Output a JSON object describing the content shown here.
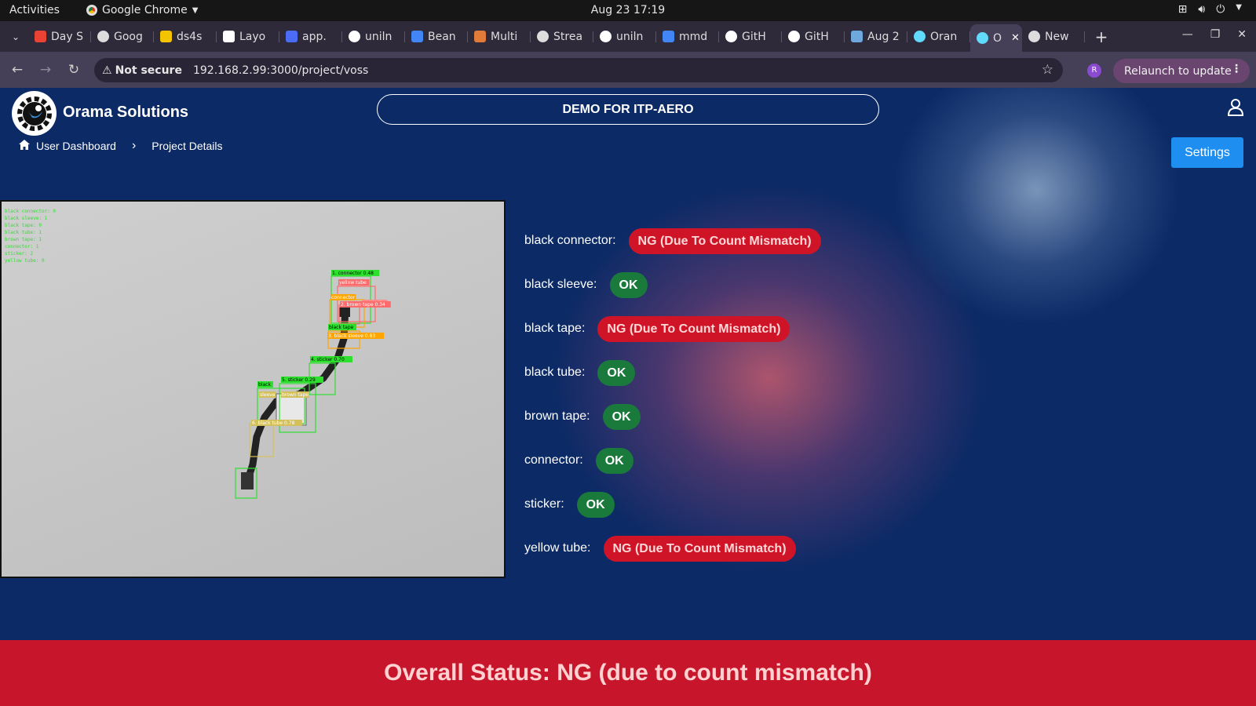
{
  "os": {
    "activities": "Activities",
    "app_name": "Google Chrome",
    "clock": "Aug 23  17:19"
  },
  "browser": {
    "tabs": [
      {
        "label": "Day S",
        "icon": "gmail-icon",
        "color": "#ea4335"
      },
      {
        "label": "Goog",
        "icon": "openai-icon",
        "color": "#dddddd"
      },
      {
        "label": "ds4s",
        "icon": "hugging-face-icon",
        "color": "#f4c400"
      },
      {
        "label": "Layo",
        "icon": "medium-icon",
        "color": "#ffffff"
      },
      {
        "label": "app.",
        "icon": "app-icon",
        "color": "#4a6cf7"
      },
      {
        "label": "uniln",
        "icon": "github-icon",
        "color": "#ffffff"
      },
      {
        "label": "Bean",
        "icon": "google-icon",
        "color": "#4285f4"
      },
      {
        "label": "Multi",
        "icon": "multi-icon",
        "color": "#e07b39"
      },
      {
        "label": "Strea",
        "icon": "openai-icon",
        "color": "#dddddd"
      },
      {
        "label": "uniln",
        "icon": "github-icon",
        "color": "#ffffff"
      },
      {
        "label": "mmd",
        "icon": "google-icon",
        "color": "#4285f4"
      },
      {
        "label": "GitH",
        "icon": "github-icon",
        "color": "#ffffff"
      },
      {
        "label": "GitH",
        "icon": "github-icon",
        "color": "#ffffff"
      },
      {
        "label": "Aug 2",
        "icon": "sparkle-icon",
        "color": "#6fa8dc"
      },
      {
        "label": "Oran",
        "icon": "react-icon",
        "color": "#61dafb"
      }
    ],
    "active_tab": {
      "label": "O",
      "icon": "react-icon",
      "color": "#61dafb"
    },
    "last_tab": {
      "label": "New",
      "icon": "chrome-icon",
      "color": "#dddddd"
    },
    "security_label": "Not secure",
    "url": "192.168.2.99:3000/project/voss",
    "profile_initial": "R",
    "relaunch_label": "Relaunch to update"
  },
  "app": {
    "brand": "Orama Solutions",
    "project_title": "DEMO FOR ITP-AERO",
    "breadcrumb": {
      "home": "User Dashboard",
      "current": "Project Details"
    },
    "settings_label": "Settings",
    "overall_status": "Overall Status: NG (due to count mismatch)",
    "status_colors": {
      "ok": "#1a7a3c",
      "ng": "#d01427"
    },
    "results": [
      {
        "label": "black connector:",
        "status": "NG (Due To Count Mismatch)",
        "kind": "ng"
      },
      {
        "label": "black sleeve:",
        "status": "OK",
        "kind": "ok"
      },
      {
        "label": "black tape:",
        "status": "NG (Due To Count Mismatch)",
        "kind": "ng"
      },
      {
        "label": "black tube:",
        "status": "OK",
        "kind": "ok"
      },
      {
        "label": "brown tape:",
        "status": "OK",
        "kind": "ok"
      },
      {
        "label": "connector:",
        "status": "OK",
        "kind": "ok"
      },
      {
        "label": "sticker:",
        "status": "OK",
        "kind": "ok"
      },
      {
        "label": "yellow tube:",
        "status": "NG (Due To Count Mismatch)",
        "kind": "ng"
      }
    ],
    "camera": {
      "overlay_counts": [
        "black connector: 0",
        "black sleeve: 1",
        "black tape: 0",
        "black tube: 1",
        "brown tape: 1",
        "connector: 1",
        "sticker: 2",
        "yellow tube: 0"
      ],
      "detections": [
        "1. connector 0.48",
        "yellow tube",
        "connector",
        "connector",
        "2. brown tape 0.34",
        "black tape",
        "3. black sleeve 0.83",
        "4. sticker 0.70",
        "5. sticker 0.29",
        "black",
        "sleeve",
        "brown tape",
        "6. black tube 0.78"
      ]
    }
  }
}
